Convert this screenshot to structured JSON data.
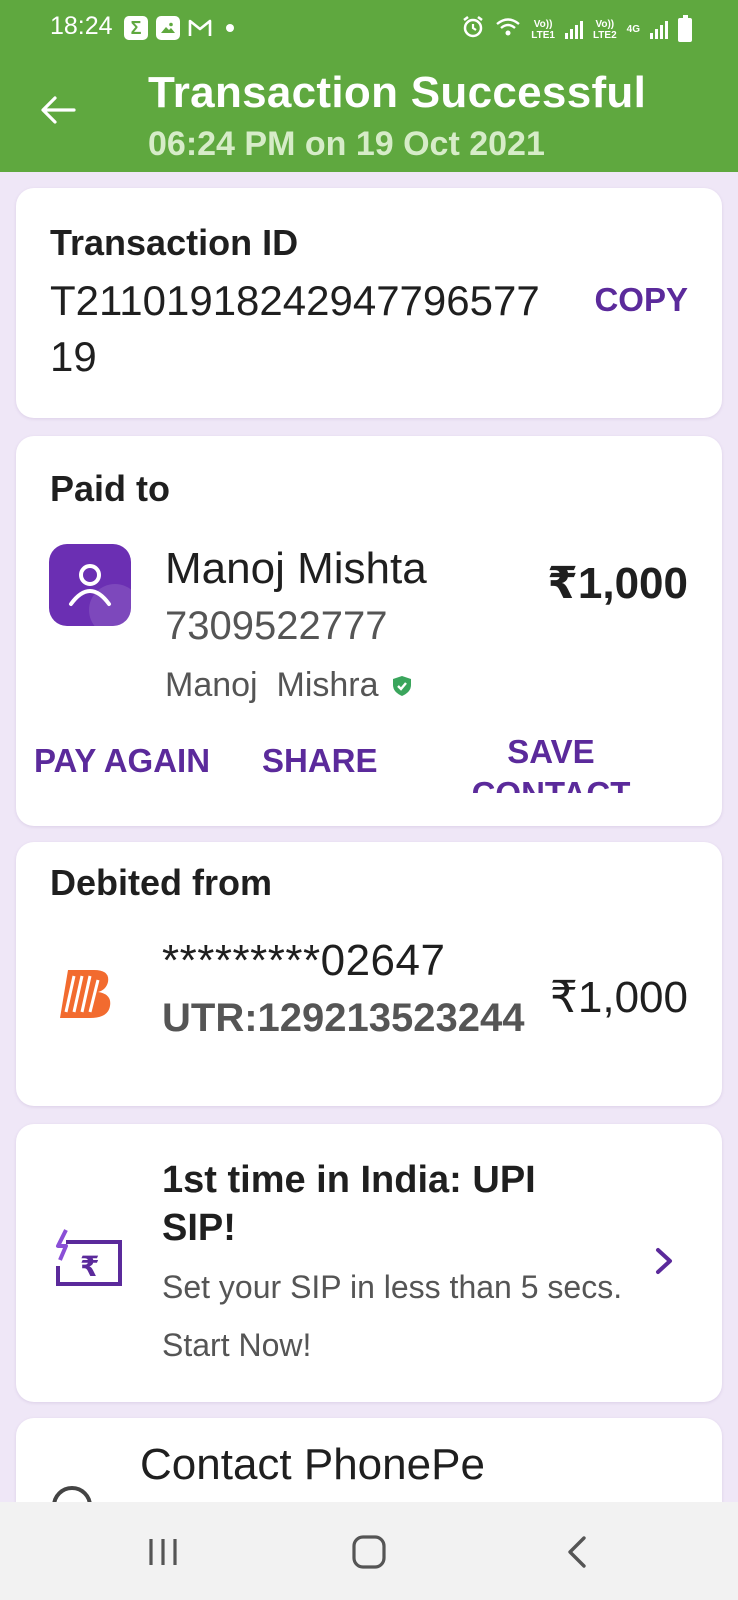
{
  "status_bar": {
    "time": "18:24",
    "left_icons": [
      "sigma-icon",
      "image-icon",
      "gmail-icon",
      "dot-icon"
    ],
    "sim1_label_top": "Vo))",
    "sim1_label_bottom": "LTE1",
    "sim2_label_top": "Vo))",
    "sim2_label_bottom": "LTE2",
    "network_type": "4G"
  },
  "header": {
    "title": "Transaction Successful",
    "subtitle": "06:24 PM on 19 Oct 2021",
    "background_color": "#5fa83f"
  },
  "transaction": {
    "label": "Transaction ID",
    "id": "T2110191824294779657719",
    "copy_label": "COPY"
  },
  "paid_to": {
    "label": "Paid to",
    "name": "Manoj Mishta",
    "phone": "7309522777",
    "verified_name": "Manoj  Mishra",
    "amount": "₹1,000",
    "actions": {
      "pay_again": "PAY AGAIN",
      "share": "SHARE",
      "save_contact": "SAVE CONTACT"
    }
  },
  "debited_from": {
    "label": "Debited from",
    "account": "*********02647",
    "utr": "UTR:129213523244",
    "amount": "₹1,000"
  },
  "promo": {
    "title": "1st time in India: UPI SIP!",
    "subtitle": "Set your SIP in less than 5 secs. Start Now!"
  },
  "contact": {
    "title": "Contact PhonePe"
  },
  "accent_color": "#5b2a9b"
}
